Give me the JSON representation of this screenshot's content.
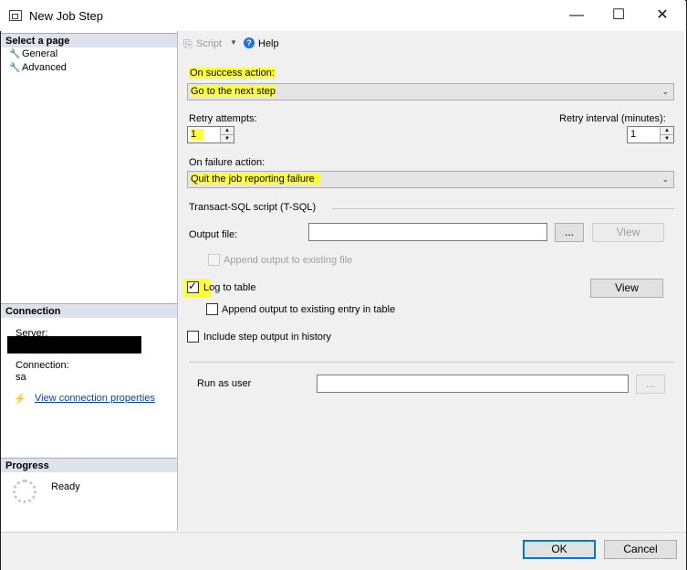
{
  "window": {
    "title": "New Job Step",
    "minimize": "—",
    "maximize": "☐",
    "close": "✕"
  },
  "left": {
    "select_page_header": "Select a page",
    "pages": [
      "General",
      "Advanced"
    ],
    "connection_header": "Connection",
    "server_label": "Server:",
    "connection_label": "Connection:",
    "connection_value": "sa",
    "view_connection_link": "View connection properties",
    "progress_header": "Progress",
    "progress_status": "Ready"
  },
  "toolbar": {
    "script_label": "Script",
    "help_label": "Help"
  },
  "form": {
    "on_success_label": "On success action:",
    "on_success_value": "Go to the next step",
    "retry_attempts_label": "Retry attempts:",
    "retry_attempts_value": "1",
    "retry_interval_label": "Retry interval (minutes):",
    "retry_interval_value": "1",
    "on_failure_label": "On failure action:",
    "on_failure_value": "Quit the job reporting failure",
    "tsql_group_label": "Transact-SQL script (T-SQL)",
    "output_file_label": "Output file:",
    "output_file_value": "",
    "browse_label": "...",
    "view_label": "View",
    "append_output_label": "Append output to existing file",
    "log_to_table_label": "Log to table",
    "append_entry_label": "Append output to existing entry in table",
    "include_history_label": "Include step output in history",
    "run_as_label": "Run as user",
    "run_as_value": "",
    "run_as_browse_label": "..."
  },
  "footer": {
    "ok_label": "OK",
    "cancel_label": "Cancel"
  },
  "colors": {
    "highlight": "#ffff33",
    "link": "#0645ad",
    "ok_border": "#0078d7"
  }
}
